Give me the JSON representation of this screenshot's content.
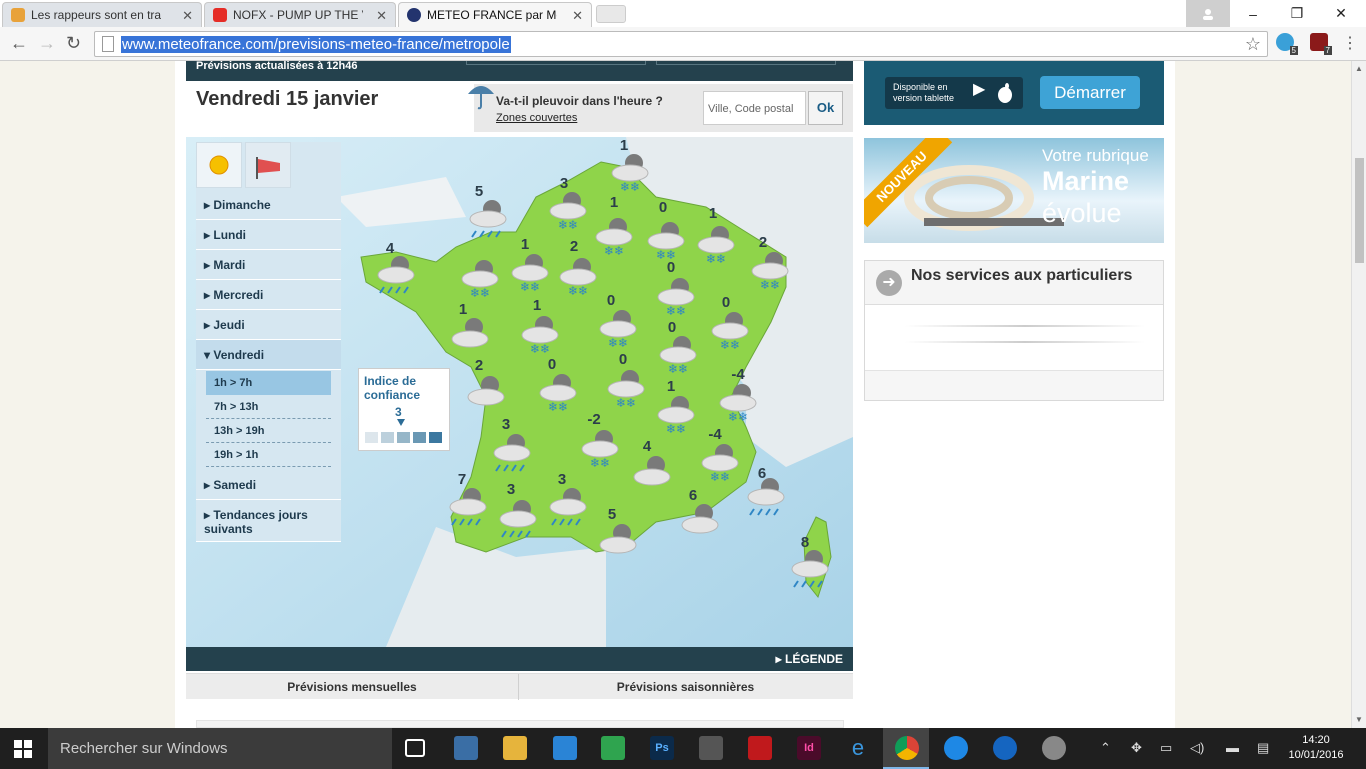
{
  "browser": {
    "tabs": [
      {
        "title": "Les rappeurs sont en train",
        "active": false
      },
      {
        "title": "NOFX - PUMP UP THE VAL",
        "active": false
      },
      {
        "title": "METEO FRANCE par Météo",
        "active": true
      }
    ],
    "url": "www.meteofrance.com/previsions-meteo-france/metropole",
    "extensions": [
      {
        "name": "ghostery",
        "badge": "5"
      },
      {
        "name": "ublock",
        "badge": "7"
      }
    ]
  },
  "header": {
    "updated": "Prévisions actualisées à 12h46",
    "date": "Vendredi 15 janvier",
    "rain_question": "Va-t-il pleuvoir dans l'heure ?",
    "zones_link": "Zones couvertes",
    "city_placeholder": "Ville, Code postal",
    "ok_label": "Ok"
  },
  "sidemenu": {
    "days": [
      "Dimanche",
      "Lundi",
      "Mardi",
      "Mercredi",
      "Jeudi",
      "Vendredi",
      "Samedi",
      "Tendances jours suivants"
    ],
    "active_day": "Vendredi",
    "time_slots": [
      "1h > 7h",
      "7h > 13h",
      "13h > 19h",
      "19h > 1h"
    ],
    "active_slot": "1h > 7h"
  },
  "confidence": {
    "label": "Indice de confiance",
    "value": "3",
    "scale_colors": [
      "#dde6ec",
      "#bcd0dc",
      "#96b6c8",
      "#6a98b4",
      "#3c78a0"
    ]
  },
  "map": {
    "temperatures": [
      "1",
      "5",
      "3",
      "1",
      "0",
      "1",
      "4",
      "1",
      "2",
      "2",
      "0",
      "1",
      "0",
      "1",
      "0",
      "0",
      "2",
      "0",
      "0",
      "1",
      "2",
      "3",
      "-4",
      "-2",
      "2",
      "4",
      "-4",
      "6",
      "7",
      "3",
      "3",
      "6",
      "5",
      "8"
    ],
    "legend_label": "LÉGENDE"
  },
  "tabs_bottom": [
    "Prévisions mensuelles",
    "Prévisions saisonnières"
  ],
  "ads": {
    "app": {
      "store_label": "Disponible en version tablette",
      "start_label": "Démarrer"
    },
    "marine": {
      "badge": "NOUVEAU",
      "line1": "Votre rubrique",
      "line2": "Marine",
      "line3": "évolue"
    }
  },
  "services": {
    "title": "Nos services aux particuliers"
  },
  "taskbar": {
    "search_placeholder": "Rechercher sur Windows",
    "time": "14:20",
    "date": "10/01/2016"
  },
  "colors": {
    "accent": "#24414d",
    "land": "#8fd44a",
    "sea": "#c9e6f3"
  }
}
